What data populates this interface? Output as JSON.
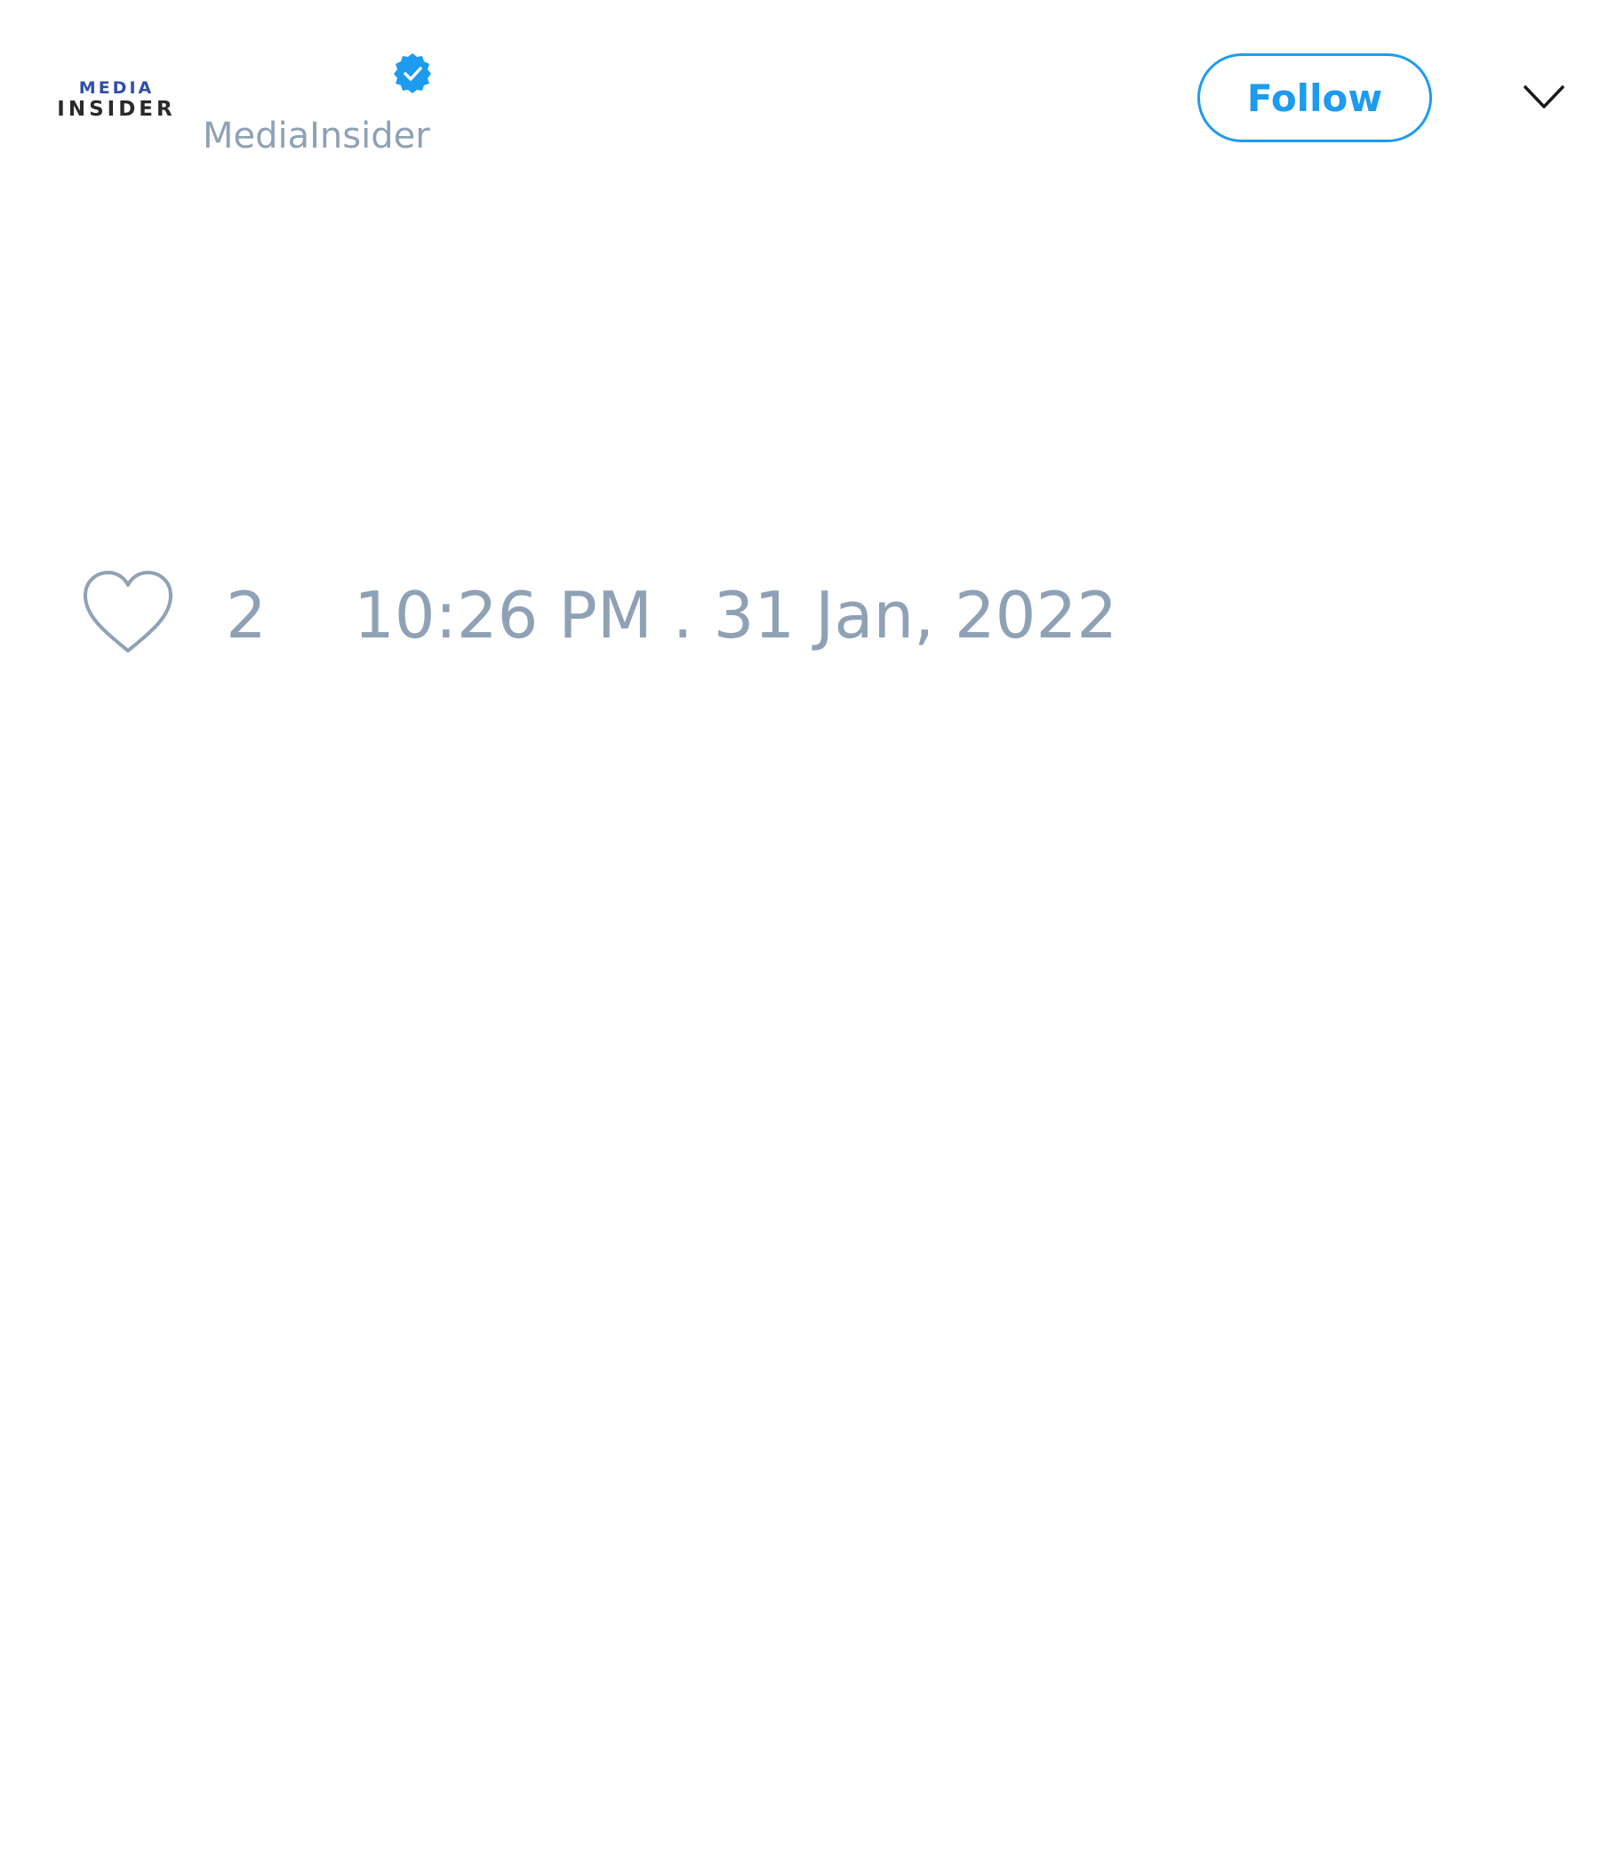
{
  "author": {
    "avatar_logo_top": "MEDIA",
    "avatar_logo_bottom": "INSIDER",
    "handle": "MediaInsider",
    "verified": true
  },
  "actions": {
    "follow_label": "Follow"
  },
  "stats": {
    "like_count": "2",
    "timestamp": "10:26 PM . 31 Jan, 2022"
  },
  "colors": {
    "accent": "#1d9bf0",
    "muted_text": "#8fa1b5",
    "background": "#ffffff"
  },
  "icons": {
    "verified": "verified-badge-icon",
    "menu": "chevron-down-icon",
    "like": "heart-icon"
  }
}
